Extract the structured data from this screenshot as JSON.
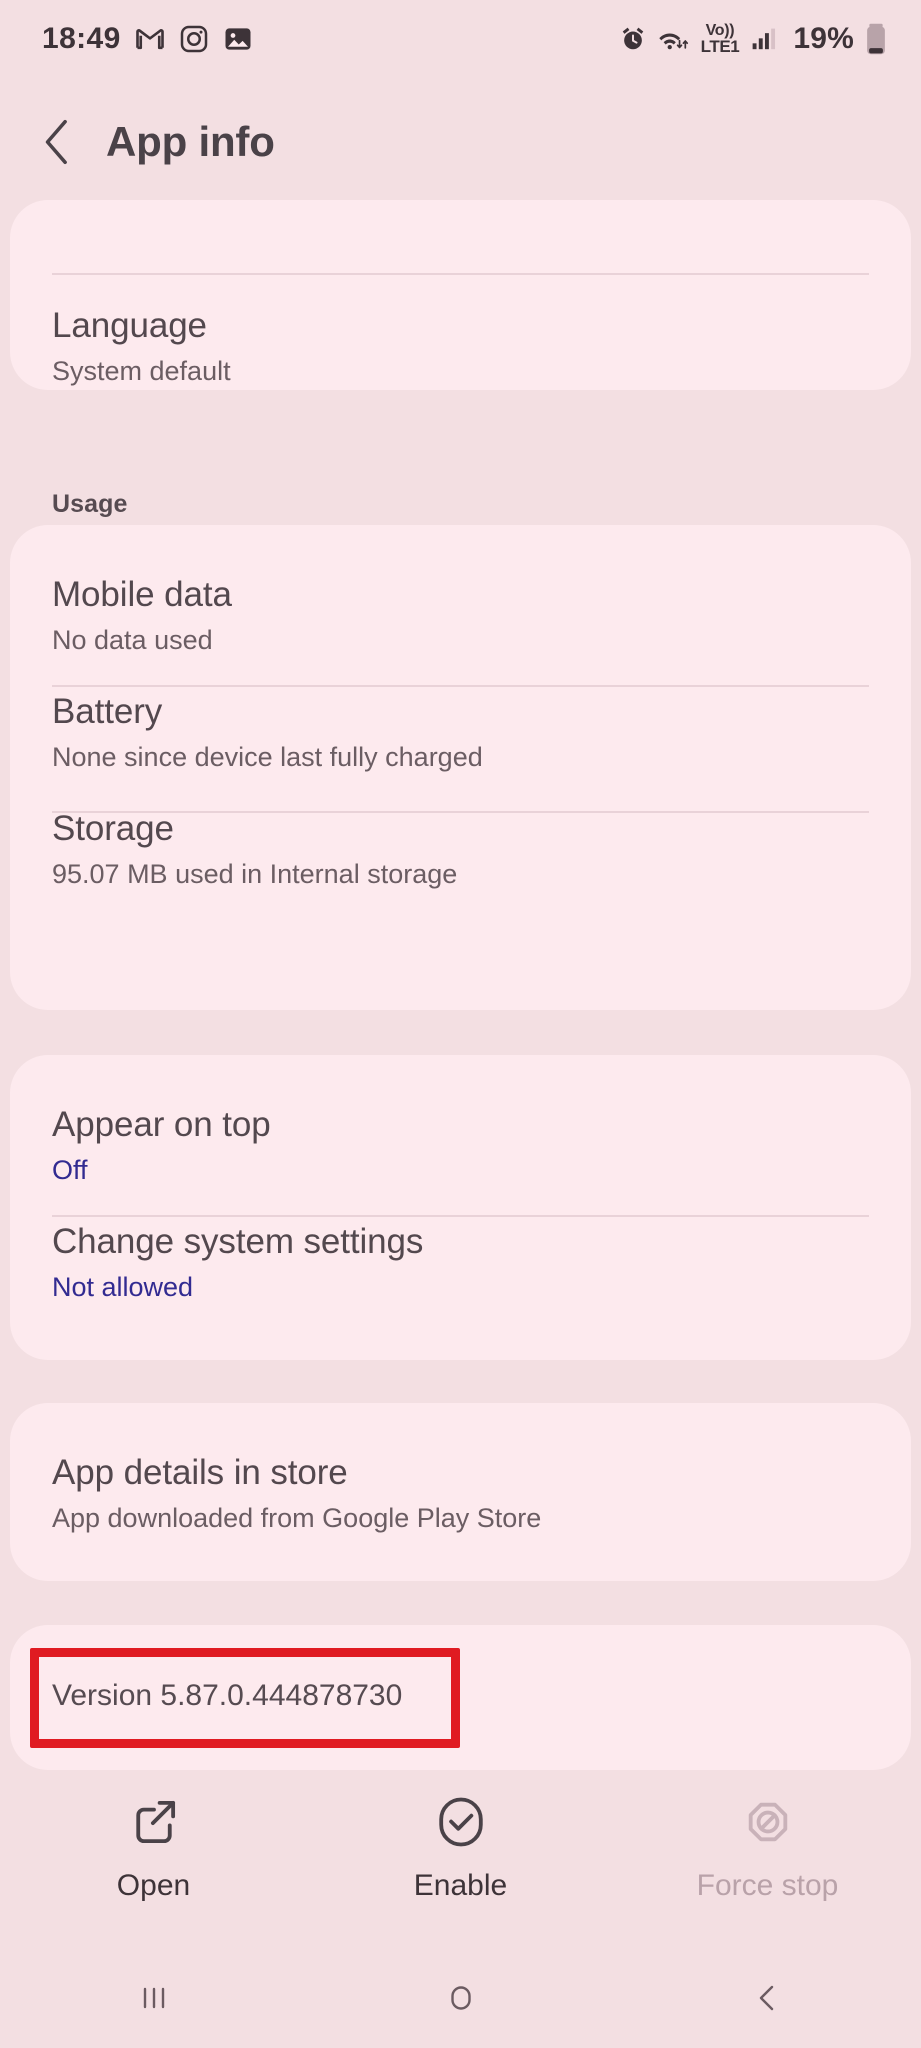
{
  "status_bar": {
    "time": "18:49",
    "battery_percent": "19%",
    "network_label": "LTE1",
    "volte_label": "Vo))",
    "left_icons": [
      "gmail-icon",
      "instagram-icon",
      "gallery-icon"
    ],
    "right_icons": [
      "alarm-icon",
      "wifi-icon",
      "volte-icon",
      "signal-icon",
      "battery-icon"
    ]
  },
  "header": {
    "title": "App info",
    "back_icon": "back-chevron-icon"
  },
  "cards": {
    "language": {
      "title": "Language",
      "subtitle": "System default"
    },
    "usage_section_label": "Usage",
    "usage": [
      {
        "title": "Mobile data",
        "subtitle": "No data used"
      },
      {
        "title": "Battery",
        "subtitle": "None since device last fully charged"
      },
      {
        "title": "Storage",
        "subtitle": "95.07 MB used in Internal storage"
      }
    ],
    "permissions": [
      {
        "title": "Appear on top",
        "subtitle": "Off",
        "accent": true
      },
      {
        "title": "Change system settings",
        "subtitle": "Not allowed",
        "accent": true
      }
    ],
    "store": {
      "title": "App details in store",
      "subtitle": "App downloaded from Google Play Store"
    },
    "version": {
      "text": "Version 5.87.0.444878730",
      "highlight_color": "#e01b22"
    }
  },
  "actions": [
    {
      "label": "Open",
      "icon": "open-external-icon",
      "disabled": false
    },
    {
      "label": "Enable",
      "icon": "check-circle-icon",
      "disabled": false
    },
    {
      "label": "Force stop",
      "icon": "block-icon",
      "disabled": true
    }
  ],
  "nav_bar": [
    {
      "name": "recents-icon"
    },
    {
      "name": "home-icon"
    },
    {
      "name": "back-icon"
    }
  ],
  "colors": {
    "page_background": "#f3dfe2",
    "card_background": "#fdeaee",
    "primary_text": "#53484e",
    "secondary_text": "#6b5d63",
    "accent_link": "#322b91",
    "annotation": "#e01b22"
  }
}
